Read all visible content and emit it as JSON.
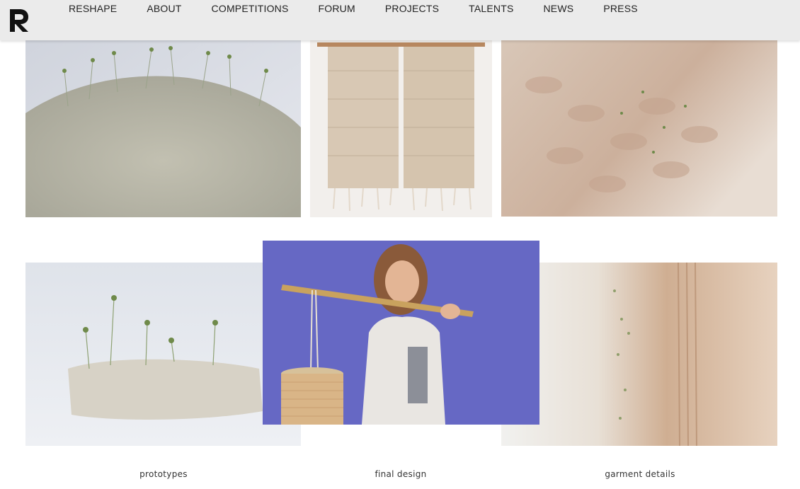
{
  "nav": {
    "logo_letter": "R",
    "items": [
      "RESHAPE",
      "ABOUT",
      "COMPETITIONS",
      "FORUM",
      "PROJECTS",
      "TALENTS",
      "NEWS",
      "PRESS"
    ]
  },
  "photos": [
    {
      "alt": "knitted fabric with sprouting seedlings"
    },
    {
      "alt": "woven hanging textile"
    },
    {
      "alt": "close-up of woven texture with seeds"
    },
    {
      "alt": "prototype fabric with sprouts"
    },
    {
      "alt": "model with bamboo pole and basket"
    },
    {
      "alt": "garment weave detail"
    }
  ],
  "captions": {
    "prototypes": "prototypes",
    "final_design": "final design",
    "garment_details": "garment details"
  },
  "colors": {
    "nav_bg": "#ebebeb",
    "nav_text": "#222222",
    "final_design_bg": "#6668c4",
    "textile": "#d9cfc2"
  }
}
